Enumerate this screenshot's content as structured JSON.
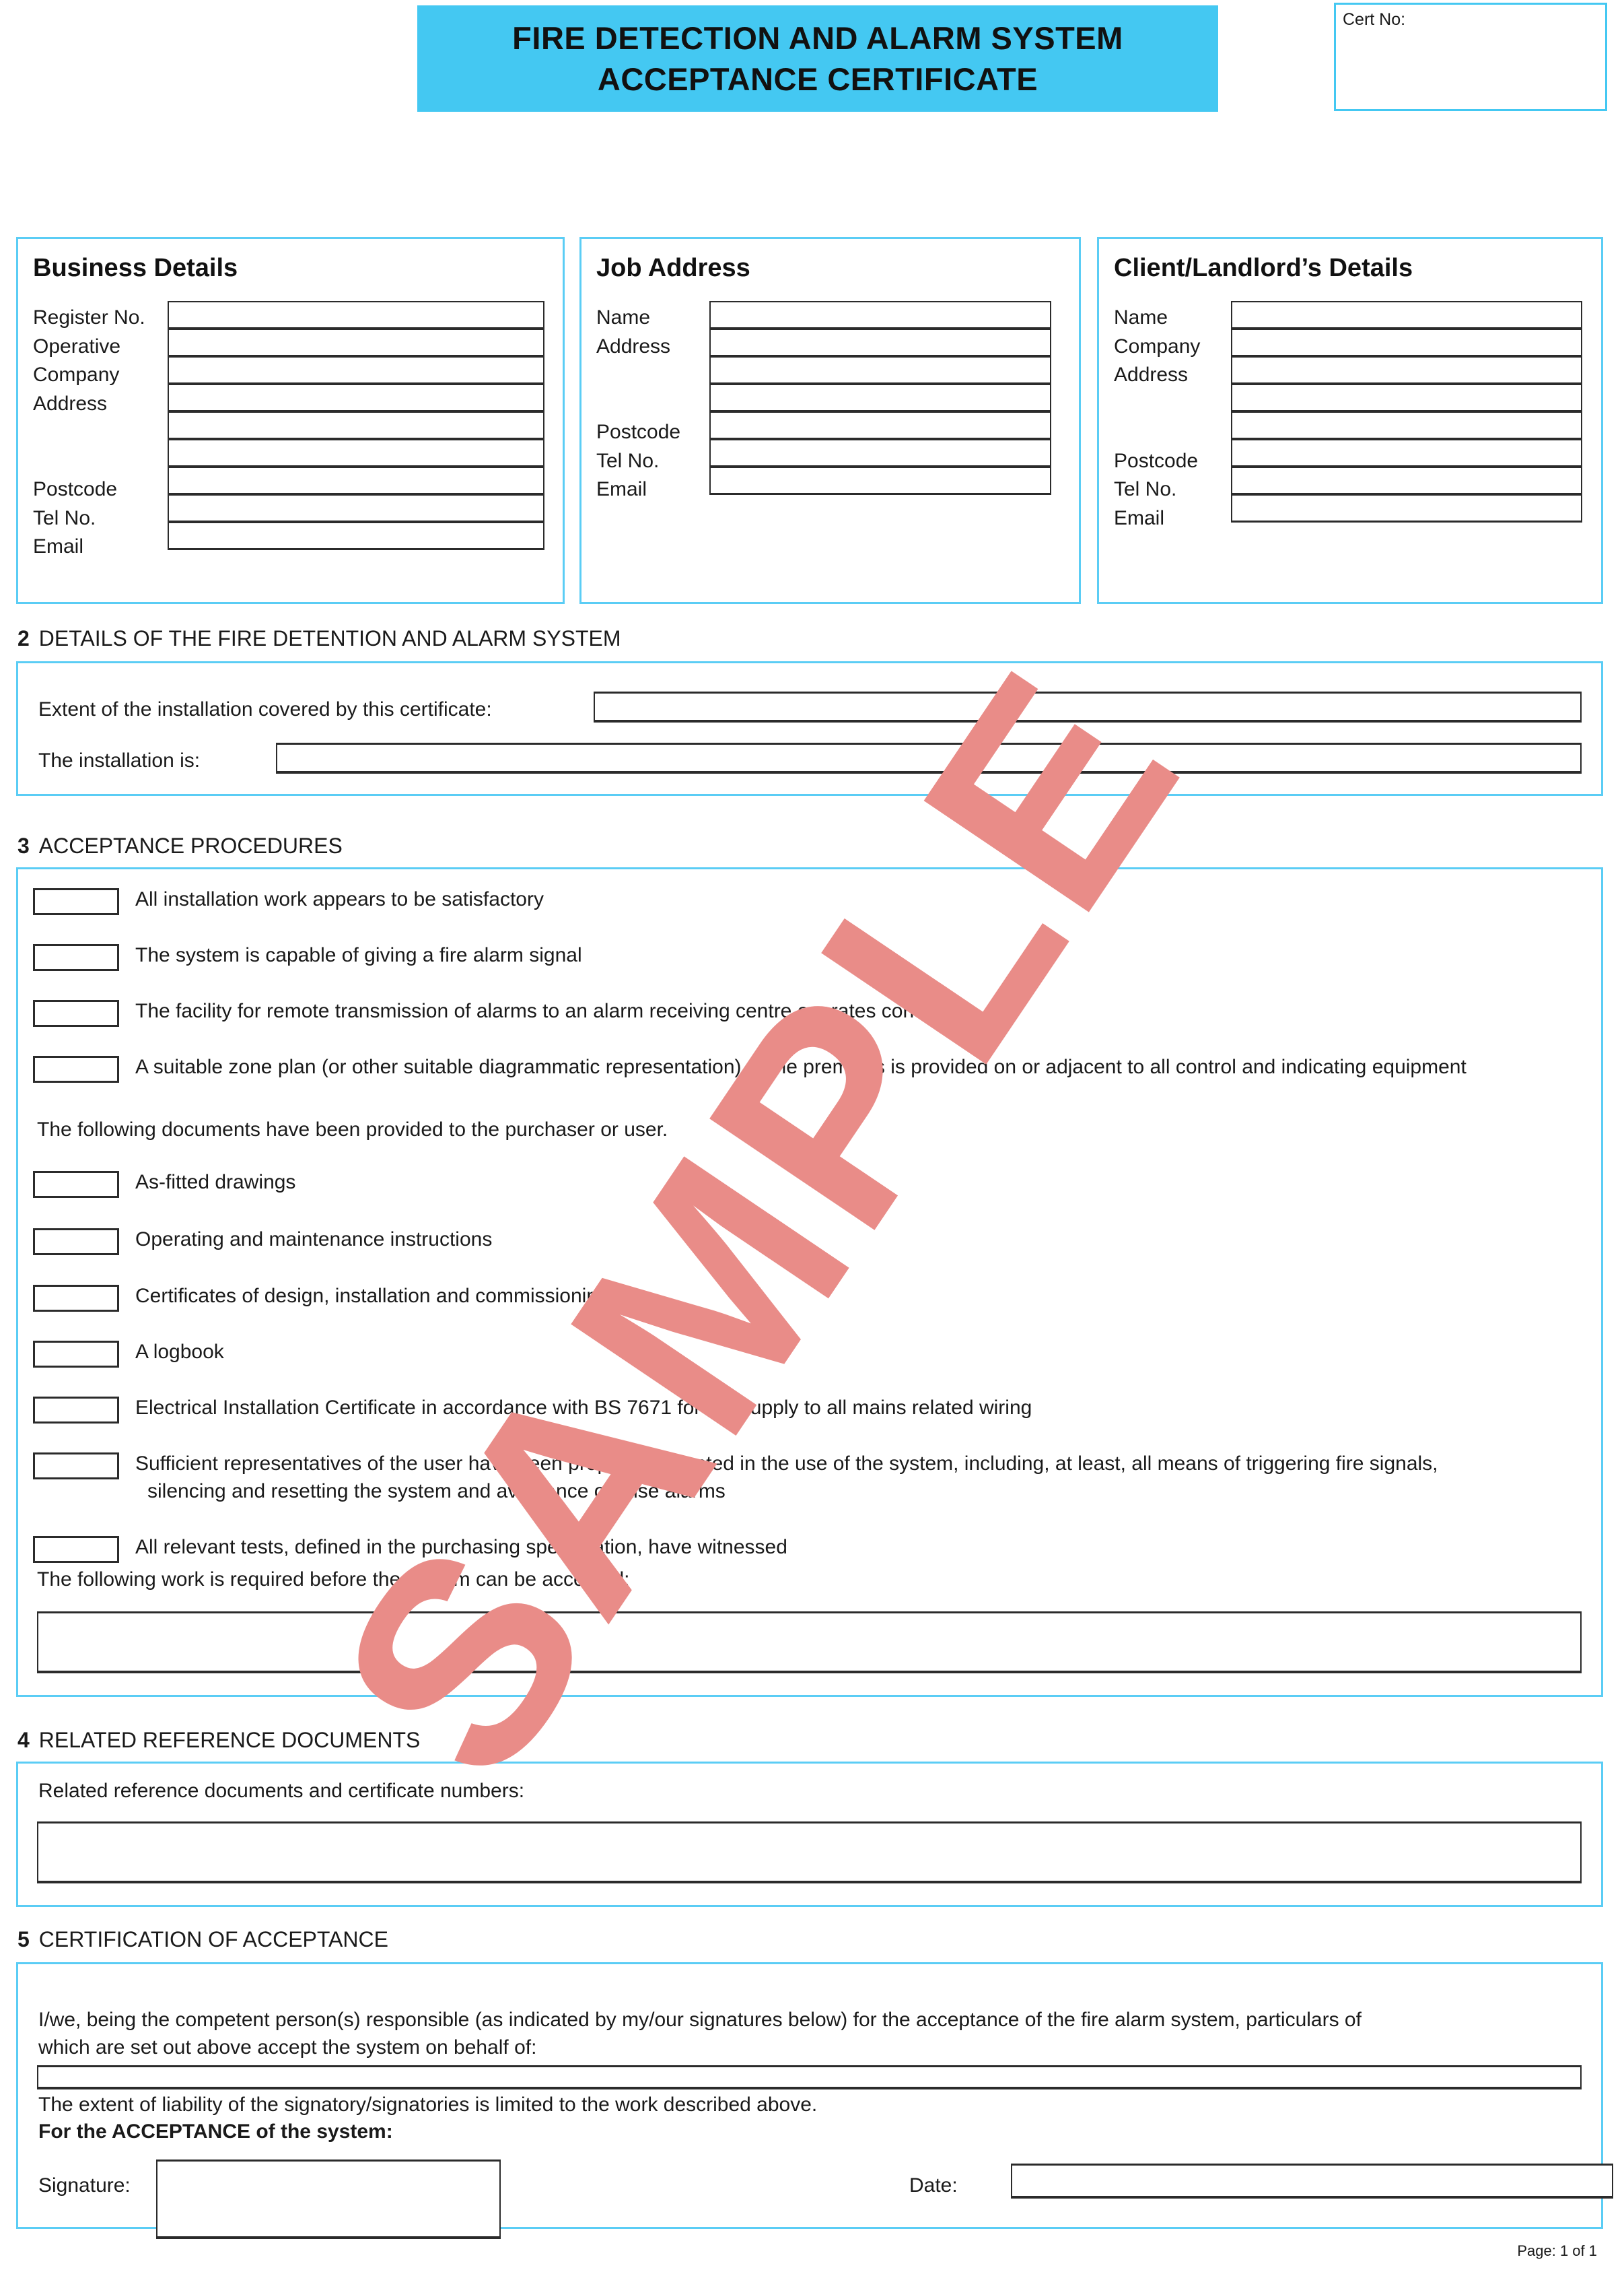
{
  "header": {
    "title_line1": "FIRE DETECTION AND ALARM SYSTEM",
    "title_line2": "ACCEPTANCE CERTIFICATE",
    "banner_color": "#44c8f2",
    "cert_no_label": "Cert No:",
    "cert_no_value": ""
  },
  "business_details": {
    "title": "Business Details",
    "labels": [
      "Register No.",
      "Operative",
      "Company",
      "Address",
      "",
      "",
      "Postcode",
      "Tel No.",
      "Email"
    ],
    "values": [
      "",
      "",
      "",
      "",
      "",
      "",
      "",
      "",
      ""
    ]
  },
  "job_address": {
    "title": "Job Address",
    "labels": [
      "Name",
      "Address",
      "",
      "",
      "Postcode",
      "Tel No.",
      "Email"
    ],
    "values": [
      "",
      "",
      "",
      "",
      "",
      "",
      ""
    ]
  },
  "client_details": {
    "title": "Client/Landlord’s Details",
    "labels": [
      "Name",
      "Company",
      "Address",
      "",
      "",
      "Postcode",
      "Tel No.",
      "Email"
    ],
    "values": [
      "",
      "",
      "",
      "",
      "",
      "",
      "",
      ""
    ]
  },
  "section2": {
    "number": "2",
    "heading": "DETAILS OF THE FIRE DETENTION AND ALARM SYSTEM",
    "extent_label": "Extent of the installation covered by this certificate:",
    "extent_value": "",
    "installation_label": "The installation is:",
    "installation_value": ""
  },
  "section3": {
    "number": "3",
    "heading": "ACCEPTANCE PROCEDURES",
    "items": [
      "All installation work appears to be satisfactory",
      "The system is capable of giving a fire alarm signal",
      "The facility for remote transmission of alarms to an alarm receiving centre operates correctly",
      "A suitable zone plan (or other suitable diagrammatic representation) of the premises is provided on or adjacent to all control and indicating equipment"
    ],
    "documents_intro": "The following documents have been provided to the purchaser or user.",
    "document_items": [
      "As-fitted drawings",
      "Operating and maintenance instructions",
      "Certificates of design, installation and commissioning",
      "A logbook",
      "Electrical Installation Certificate in accordance with BS 7671 for the supply to all mains related wiring"
    ],
    "representatives_item_line1": "Sufficient representatives of the user have been properly instructed in the use of the system, including, at least, all means of triggering fire signals,",
    "representatives_item_line2": "silencing and resetting the system and avoidance of false alarms",
    "tests_item": "All relevant tests, defined in the purchasing specification, have witnessed",
    "work_required_label": "The following work is required before the system can be accepted:",
    "work_required_value": ""
  },
  "section4": {
    "number": "4",
    "heading": "RELATED REFERENCE DOCUMENTS",
    "field_label": "Related reference documents and certificate numbers:",
    "field_value": ""
  },
  "section5": {
    "number": "5",
    "heading": "CERTIFICATION OF ACCEPTANCE",
    "declaration_line1": "I/we, being the competent person(s) responsible (as indicated by my/our signatures below) for the acceptance of the fire alarm system, particulars of",
    "declaration_line2": "which are set out above accept the system on behalf of:",
    "behalf_of_value": "",
    "liability_text": "The extent of liability of the signatory/signatories is limited to the work described above.",
    "acceptance_heading": "For the ACCEPTANCE of the system:",
    "signature_label": "Signature:",
    "signature_value": "",
    "date_label": "Date:",
    "date_value": ""
  },
  "footer": {
    "page_text": "Page: 1 of 1"
  },
  "watermark": {
    "text": "SAMPLE",
    "color": "#e98c88"
  }
}
